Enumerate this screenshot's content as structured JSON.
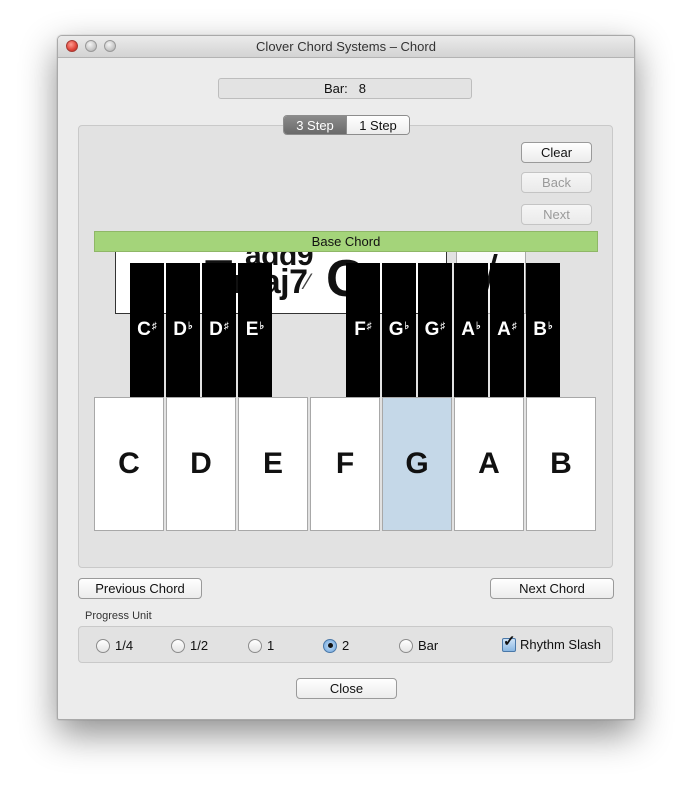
{
  "window": {
    "title": "Clover Chord Systems – Chord"
  },
  "bar": {
    "label": "Bar:",
    "value": "8"
  },
  "step_tabs": [
    {
      "label": "3 Step",
      "selected": true
    },
    {
      "label": "1 Step",
      "selected": false
    }
  ],
  "chord": {
    "root": "F",
    "quality_top": "add9",
    "quality_bottom": "maj7",
    "slash": "⁄",
    "bass": "G"
  },
  "slash_button": {
    "label": "/"
  },
  "buttons": {
    "clear": "Clear",
    "back": "Back",
    "next": "Next",
    "previous_chord": "Previous Chord",
    "next_chord": "Next Chord",
    "close": "Close"
  },
  "base_chord_label": "Base Chord",
  "white_keys": [
    {
      "label": "C",
      "highlighted": false
    },
    {
      "label": "D",
      "highlighted": false
    },
    {
      "label": "E",
      "highlighted": false
    },
    {
      "label": "F",
      "highlighted": false
    },
    {
      "label": "G",
      "highlighted": true
    },
    {
      "label": "A",
      "highlighted": false
    },
    {
      "label": "B",
      "highlighted": false
    }
  ],
  "black_keys": [
    {
      "note": "C",
      "accidental": "♯"
    },
    {
      "note": "D",
      "accidental": "♭"
    },
    {
      "note": "D",
      "accidental": "♯"
    },
    {
      "note": "E",
      "accidental": "♭"
    },
    {
      "note": "F",
      "accidental": "♯"
    },
    {
      "note": "G",
      "accidental": "♭"
    },
    {
      "note": "G",
      "accidental": "♯"
    },
    {
      "note": "A",
      "accidental": "♭"
    },
    {
      "note": "A",
      "accidental": "♯"
    },
    {
      "note": "B",
      "accidental": "♭"
    }
  ],
  "progress_unit": {
    "label": "Progress Unit",
    "options": [
      {
        "label": "1/4",
        "selected": false
      },
      {
        "label": "1/2",
        "selected": false
      },
      {
        "label": "1",
        "selected": false
      },
      {
        "label": "2",
        "selected": true
      },
      {
        "label": "Bar",
        "selected": false
      }
    ],
    "rhythm_slash": {
      "label": "Rhythm Slash",
      "checked": true
    }
  },
  "colors": {
    "base_chord_bar": "#a4d47a",
    "highlight_key": "#c5d8e8",
    "segment_selected": "#7a7a7a"
  }
}
